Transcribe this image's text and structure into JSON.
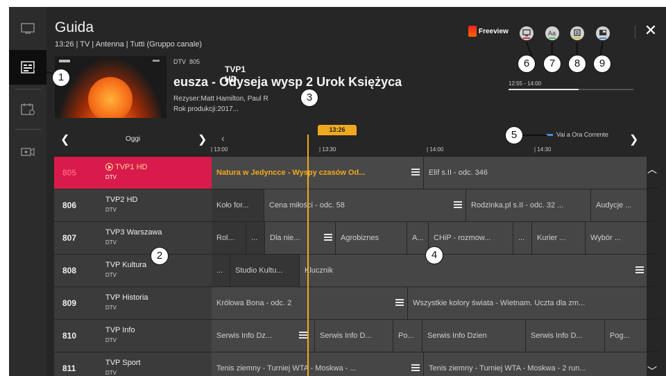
{
  "nav": {
    "items": [
      {
        "name": "tv-icon"
      },
      {
        "name": "guide-icon"
      },
      {
        "name": "schedule-icon"
      },
      {
        "name": "recordings-icon"
      }
    ]
  },
  "header": {
    "title": "Guida",
    "subtitle": "13:26 | TV | Antenna | Tutti (Gruppo canale)",
    "freeview_label": "Freeview",
    "close_label": "✕"
  },
  "program": {
    "source": "DTV",
    "channel_number": "805",
    "channel_name": "TVP1 HD",
    "title": "eusza - Odyseja wysp 2 Urok Księżyca",
    "director": "Rezyser:Matt Hamilton, Paul R",
    "year": "Rok produkcji:2017...",
    "time_range": "12:55 - 14:00",
    "progress": 0.56
  },
  "timeline": {
    "date_label": "Oggi",
    "now_label": "13:26",
    "ticks": [
      "13:00",
      "13:30",
      "14:00",
      "14:30"
    ],
    "goto_now_label": "Vai a Ora Corrente"
  },
  "channels": [
    {
      "number": "805",
      "name": "TVP1 HD",
      "type": "DTV",
      "selected": true,
      "programs": [
        "Natura w Jedyncce - Wyspy czasów Od...",
        "Elif s.II - odc. 346"
      ]
    },
    {
      "number": "806",
      "name": "TVP2 HD",
      "type": "DTV",
      "programs": [
        "Koło for...",
        "Cena miłości - odc. 58",
        "Rodzinka.pl s.II - odc. 32 ...",
        "Audycje ..."
      ]
    },
    {
      "number": "807",
      "name": "TVP3 Warszawa",
      "type": "DTV",
      "programs": [
        "Rol...",
        "...",
        "Dla nie...",
        "Agrobiznes",
        "A...",
        "CHiP - rozmow...",
        "...",
        "Kurier ...",
        "Wybór ..."
      ]
    },
    {
      "number": "808",
      "name": "TVP Kultura",
      "type": "DTV",
      "programs": [
        "...",
        "Studio Kultu...",
        "Klucznik"
      ]
    },
    {
      "number": "809",
      "name": "TVP Historia",
      "type": "DTV",
      "programs": [
        "Królowa Bona - odc. 2",
        "Wszystkie kolory świata - Wietnam. Uczta dla zm..."
      ]
    },
    {
      "number": "810",
      "name": "TVP Info",
      "type": "DTV",
      "programs": [
        "Serwis Info Dz...",
        "Serwis Info D...",
        "Po...",
        "Serwis Info Dzien",
        "Serwis Info D...",
        "Pog..."
      ]
    },
    {
      "number": "811",
      "name": "TVP Sport",
      "type": "DTV",
      "programs": [
        "Tenis ziemny - Turniej WTA - Moskwa - ...",
        "Tenis ziemny - Turniej WTA - Moskwa - 2 run..."
      ]
    }
  ],
  "callouts": [
    "1",
    "2",
    "3",
    "4",
    "5",
    "6",
    "7",
    "8",
    "9"
  ],
  "colors": {
    "accent": "#f0a91f",
    "selected_channel": "#d81b4b",
    "icon_bar_red": "#e03040",
    "icon_bar_green": "#3fbf4f",
    "icon_bar_yellow": "#e8c21a",
    "icon_bar_blue": "#3d8fe0"
  }
}
